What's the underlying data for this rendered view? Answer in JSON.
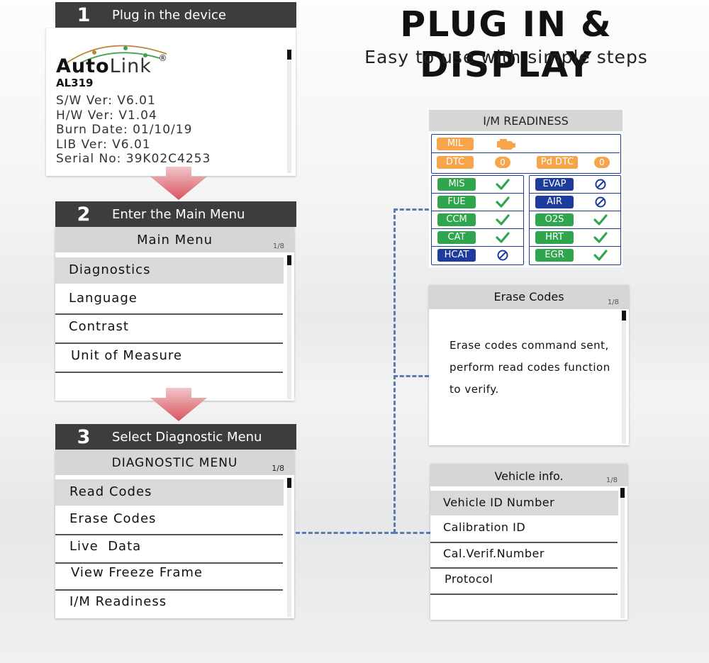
{
  "hero": {
    "title": "PLUG IN & DISPLAY",
    "subtitle": "Easy to use with simple steps"
  },
  "steps": [
    {
      "num": "1",
      "label": "Plug in the device"
    },
    {
      "num": "2",
      "label": "Enter the Main Menu"
    },
    {
      "num": "3",
      "label": "Select Diagnostic Menu"
    }
  ],
  "device": {
    "brand_a": "Auto",
    "brand_b": "Link",
    "reg": "®",
    "model": "AL319",
    "lines": [
      "S/W Ver: V6.01",
      "H/W Ver: V1.04",
      "Burn Date: 01/10/19",
      "LIB Ver: V6.01",
      "Serial No: 39K02C4253"
    ]
  },
  "main_menu": {
    "title": "Main Menu",
    "page": "1/8",
    "items": [
      "Diagnostics",
      "Language",
      "Contrast",
      "Unit of Measure"
    ]
  },
  "diag_menu": {
    "title": "DIAGNOSTIC MENU",
    "page": "1/8",
    "items": [
      "Read Codes",
      "Erase Codes",
      "Live  Data",
      "View Freeze Frame",
      "I/M Readiness"
    ]
  },
  "im": {
    "title": "I/M READINESS",
    "mil": "MIL",
    "dtc": "DTC",
    "dtc_count": "0",
    "pd_dtc": "Pd DTC",
    "pd_dtc_count": "0",
    "left": [
      {
        "label": "MIS",
        "color": "green",
        "status": "check"
      },
      {
        "label": "FUE",
        "color": "green",
        "status": "check"
      },
      {
        "label": "CCM",
        "color": "green",
        "status": "check"
      },
      {
        "label": "CAT",
        "color": "green",
        "status": "check"
      },
      {
        "label": "HCAT",
        "color": "blue",
        "status": "na"
      }
    ],
    "right": [
      {
        "label": "EVAP",
        "color": "blue",
        "status": "na"
      },
      {
        "label": "AIR",
        "color": "blue",
        "status": "na"
      },
      {
        "label": "O2S",
        "color": "green",
        "status": "check"
      },
      {
        "label": "HRT",
        "color": "green",
        "status": "check"
      },
      {
        "label": "EGR",
        "color": "green",
        "status": "check"
      }
    ],
    "colors": {
      "orange": "#f6a54b",
      "green": "#2fa64d",
      "blue": "#1d3b9c"
    }
  },
  "erase": {
    "title": "Erase Codes",
    "page": "1/8",
    "lines": [
      "Erase codes command sent,",
      "perform read codes function",
      "to verify."
    ]
  },
  "vehicle": {
    "title": "Vehicle info.",
    "page": "1/8",
    "items": [
      "Vehicle ID Number",
      "Calibration ID",
      "Cal.Verif.Number",
      "Protocol"
    ]
  }
}
